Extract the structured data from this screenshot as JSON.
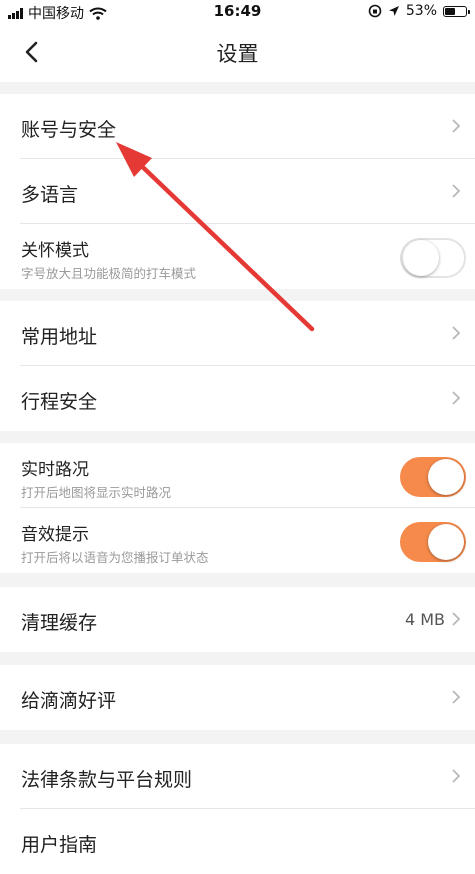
{
  "status_bar": {
    "carrier": "中国移动",
    "time": "16:49",
    "battery": "53%",
    "battery_level": 0.53
  },
  "nav": {
    "title": "设置"
  },
  "groups": [
    {
      "items": [
        {
          "label": "账号与安全"
        },
        {
          "label": "多语言"
        },
        {
          "label": "关怀模式",
          "sub": "字号放大且功能极简的打车模式",
          "toggle": false
        }
      ]
    },
    {
      "items": [
        {
          "label": "常用地址"
        },
        {
          "label": "行程安全"
        }
      ]
    },
    {
      "items": [
        {
          "label": "实时路况",
          "sub": "打开后地图将显示实时路况",
          "toggle": true
        },
        {
          "label": "音效提示",
          "sub": "打开后将以语音为您播报订单状态",
          "toggle": true
        }
      ]
    },
    {
      "items": [
        {
          "label": "清理缓存",
          "value": "4 MB"
        }
      ]
    },
    {
      "items": [
        {
          "label": "给滴滴好评"
        }
      ]
    },
    {
      "items": [
        {
          "label": "法律条款与平台规则"
        },
        {
          "label": "用户指南"
        }
      ]
    }
  ],
  "colors": {
    "accent": "#f58a4b",
    "annotation_arrow": "#e53935"
  },
  "icons": {
    "back": "chevron-left-icon",
    "chevron": "chevron-right-icon"
  }
}
